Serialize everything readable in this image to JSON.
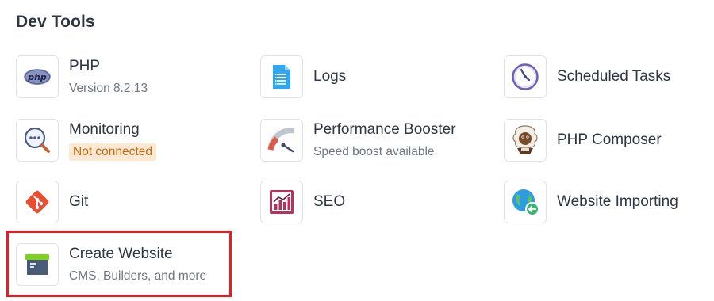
{
  "section": {
    "title": "Dev Tools"
  },
  "tools": {
    "php": {
      "title": "PHP",
      "subtitle": "Version 8.2.13",
      "icon": "php-icon"
    },
    "logs": {
      "title": "Logs",
      "icon": "logs-document-icon"
    },
    "scheduled_tasks": {
      "title": "Scheduled Tasks",
      "icon": "clock-icon"
    },
    "monitoring": {
      "title": "Monitoring",
      "status": "Not connected",
      "icon": "monitoring-magnifier-icon"
    },
    "performance_booster": {
      "title": "Performance Booster",
      "subtitle": "Speed boost available",
      "icon": "speedometer-icon"
    },
    "php_composer": {
      "title": "PHP Composer",
      "icon": "composer-mascot-icon"
    },
    "git": {
      "title": "Git",
      "icon": "git-icon"
    },
    "seo": {
      "title": "SEO",
      "icon": "seo-chart-icon"
    },
    "website_importing": {
      "title": "Website Importing",
      "icon": "globe-import-icon"
    },
    "create_website": {
      "title": "Create Website",
      "subtitle": "CMS, Builders, and more",
      "icon": "website-box-icon"
    }
  },
  "colors": {
    "highlight": "#e21e26",
    "warning_bg": "#fde9d3",
    "warning_text": "#c46a10",
    "accent_blue": "#2f80ed"
  }
}
